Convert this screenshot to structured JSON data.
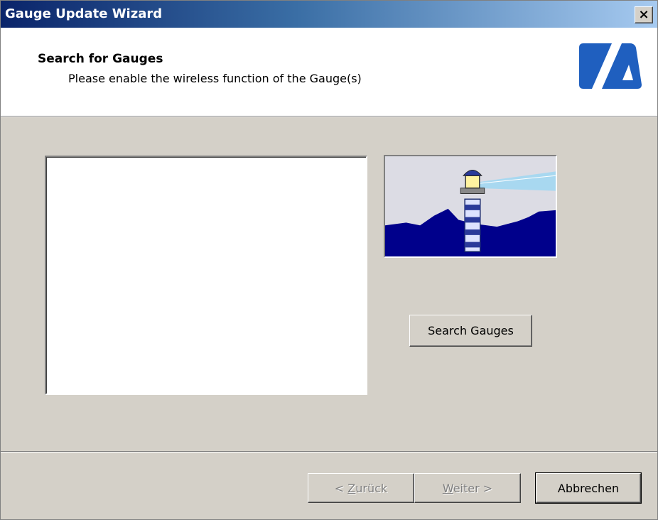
{
  "window": {
    "title": "Gauge Update Wizard",
    "close_symbol": "×"
  },
  "header": {
    "title": "Search for Gauges",
    "subtitle": "Please enable the wireless function of the Gauge(s)",
    "logo_icon": "brand-logo-icon"
  },
  "main": {
    "gauge_list": [],
    "illustration_icon": "lighthouse-icon",
    "search_button_label": "Search Gauges"
  },
  "footer": {
    "back_prefix": "< ",
    "back_mnemonic": "Z",
    "back_rest": "urück",
    "next_mnemonic": "W",
    "next_rest": "eiter >",
    "cancel_label": "Abbrechen"
  },
  "colors": {
    "accent": "#1f5fbf",
    "sea": "#00008b"
  }
}
